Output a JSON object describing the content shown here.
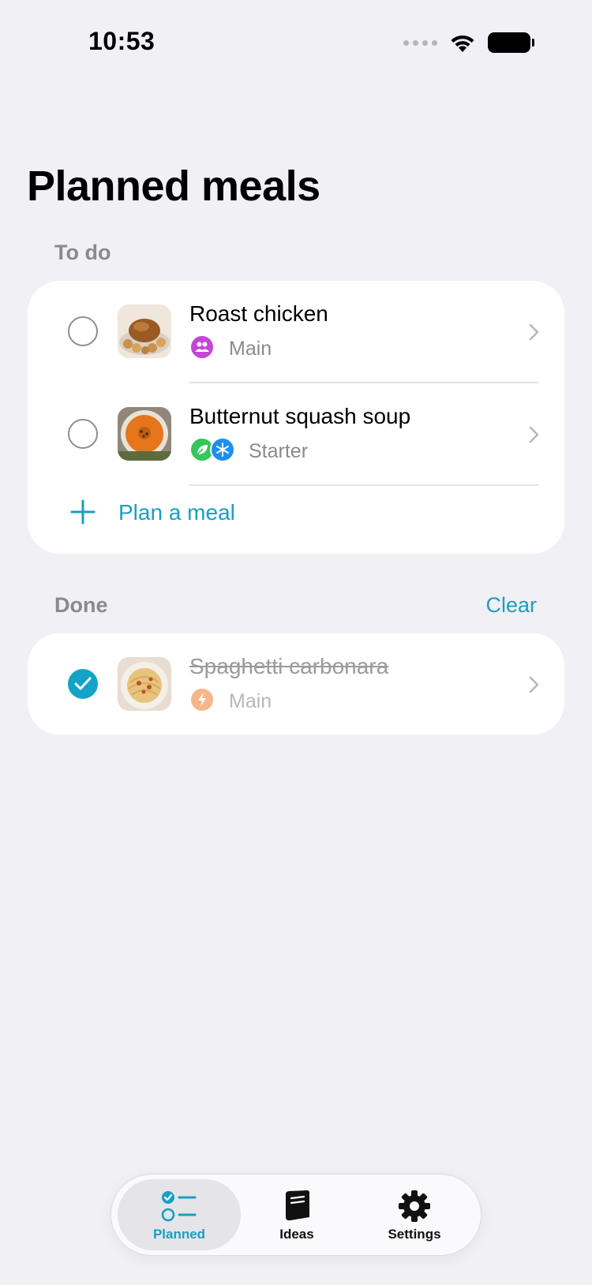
{
  "status_bar": {
    "time": "10:53"
  },
  "page_title": "Planned meals",
  "todo_section": {
    "label": "To do",
    "items": [
      {
        "name": "Roast chicken",
        "category": "Main",
        "category_icons": [
          "people-icon"
        ],
        "done": false
      },
      {
        "name": "Butternut squash soup",
        "category": "Starter",
        "category_icons": [
          "leaf-icon",
          "snowflake-icon"
        ],
        "done": false
      }
    ],
    "add_label": "Plan a meal"
  },
  "done_section": {
    "label": "Done",
    "clear_label": "Clear",
    "items": [
      {
        "name": "Spaghetti carbonara",
        "category": "Main",
        "category_icons": [
          "lightning-icon"
        ],
        "done": true
      }
    ]
  },
  "tabbar": {
    "tabs": [
      {
        "label": "Planned",
        "icon": "checklist-icon",
        "active": true
      },
      {
        "label": "Ideas",
        "icon": "book-icon",
        "active": false
      },
      {
        "label": "Settings",
        "icon": "gear-icon",
        "active": false
      }
    ]
  },
  "colors": {
    "accent": "#1a9fbe",
    "background": "#f0f0f5",
    "people_badge": "#c446d6",
    "leaf_badge": "#34c759",
    "snow_badge": "#1e8ef0",
    "lightning_badge": "#f7b58a"
  }
}
